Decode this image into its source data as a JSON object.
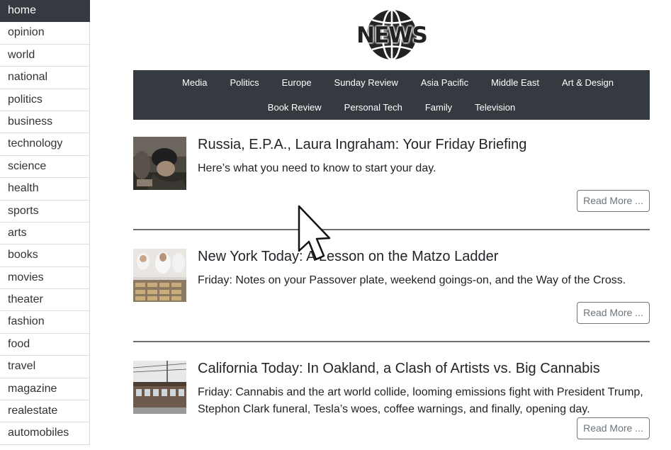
{
  "sidebar": {
    "items": [
      {
        "label": "home",
        "active": true
      },
      {
        "label": "opinion"
      },
      {
        "label": "world"
      },
      {
        "label": "national"
      },
      {
        "label": "politics"
      },
      {
        "label": "business"
      },
      {
        "label": "technology"
      },
      {
        "label": "science"
      },
      {
        "label": "health"
      },
      {
        "label": "sports"
      },
      {
        "label": "arts"
      },
      {
        "label": "books"
      },
      {
        "label": "movies"
      },
      {
        "label": "theater"
      },
      {
        "label": "fashion"
      },
      {
        "label": "food"
      },
      {
        "label": "travel"
      },
      {
        "label": "magazine"
      },
      {
        "label": "realestate"
      },
      {
        "label": "automobiles"
      }
    ]
  },
  "header": {
    "logo_text": "NEWS",
    "logo_icon": "globe-icon"
  },
  "navbar": {
    "row1": [
      "Media",
      "Politics",
      "Europe",
      "Sunday Review",
      "Asia Pacific",
      "Middle East",
      "Art & Design"
    ],
    "row2": [
      "Book Review",
      "Personal Tech",
      "Family",
      "Television"
    ]
  },
  "articles": [
    {
      "title": "Russia, E.P.A., Laura Ingraham: Your Friday Briefing",
      "abstract": "Here’s what you need to know to start your day.",
      "read_more": "Read More ..."
    },
    {
      "title": "New York Today: A Lesson on the Matzo Ladder",
      "abstract": "Friday: Notes on your Passover plate, weekend goings-on, and the Way of the Cross.",
      "read_more": "Read More ..."
    },
    {
      "title": "California Today: In Oakland, a Clash of Artists vs. Big Cannabis",
      "abstract": "Friday: Cannabis and the art world collide, looming emissions fight with President Trump, Stephon Clark funeral, Tesla’s woes, coffee warnings, and finally, opening day.",
      "read_more": "Read More ..."
    }
  ],
  "colors": {
    "navbar_bg": "#343a40",
    "active_sidebar_bg": "#343a40",
    "button_border": "#6c757d"
  }
}
